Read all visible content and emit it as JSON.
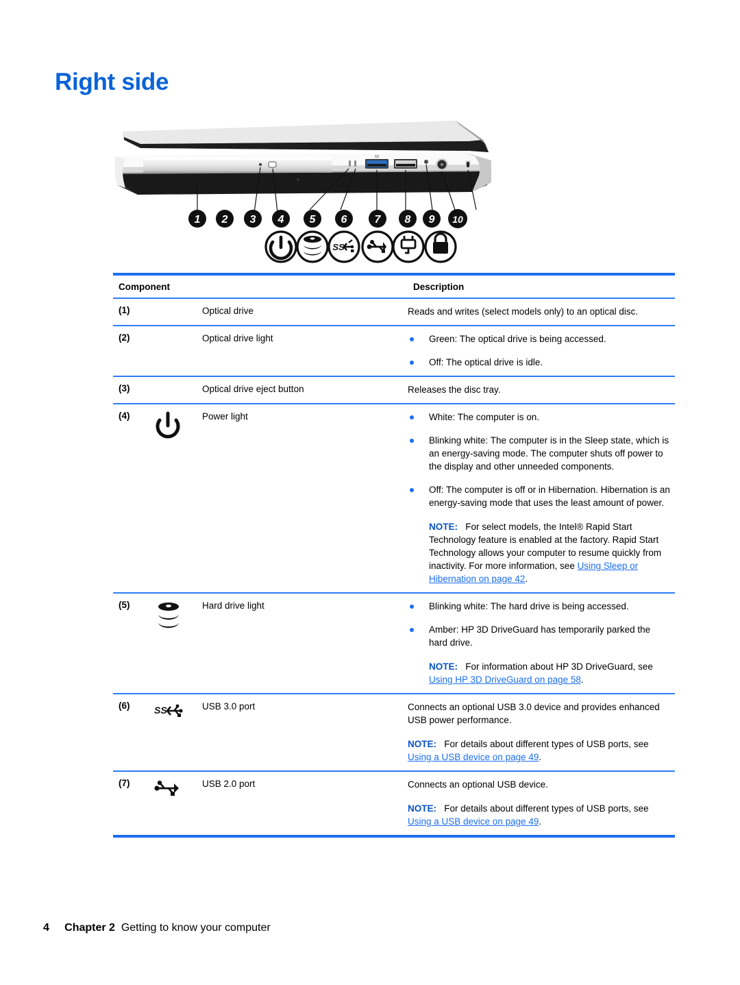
{
  "document": {
    "title": "Right side"
  },
  "figure": {
    "name": "laptop-right-side-photo",
    "callouts": [
      "1",
      "2",
      "3",
      "4",
      "5",
      "6",
      "7",
      "8",
      "9",
      "10"
    ],
    "icons": [
      "power-icon",
      "hard-drive-icon",
      "usb-3-icon",
      "usb-2-icon",
      "power-connector-icon",
      "lock-icon"
    ]
  },
  "table": {
    "headers": {
      "component": "Component",
      "description": "Description"
    },
    "rows": [
      {
        "num": "(1)",
        "icon": "",
        "name": "Optical drive",
        "desc_plain": "Reads and writes (select models only) to an optical disc."
      },
      {
        "num": "(2)",
        "icon": "",
        "name": "Optical drive light",
        "bullets": [
          "Green: The optical drive is being accessed.",
          "Off: The optical drive is idle."
        ]
      },
      {
        "num": "(3)",
        "icon": "",
        "name": "Optical drive eject button",
        "desc_plain": "Releases the disc tray."
      },
      {
        "num": "(4)",
        "icon": "power-icon",
        "name": "Power light",
        "bullets": [
          "White: The computer is on.",
          "Blinking white: The computer is in the Sleep state, which is an energy-saving mode. The computer shuts off power to the display and other unneeded components.",
          "Off: The computer is off or in Hibernation. Hibernation is an energy-saving mode that uses the least amount of power."
        ],
        "note": {
          "label": "NOTE:",
          "text": "For select models, the Intel® Rapid Start Technology feature is enabled at the factory. Rapid Start Technology allows your computer to resume quickly from inactivity. For more information, see ",
          "link": "Using Sleep or Hibernation on page 42",
          "after": "."
        }
      },
      {
        "num": "(5)",
        "icon": "hard-drive-icon",
        "name": "Hard drive light",
        "bullets": [
          "Blinking white: The hard drive is being accessed.",
          "Amber: HP 3D DriveGuard has temporarily parked the hard drive."
        ],
        "note": {
          "label": "NOTE:",
          "text": "For information about HP 3D DriveGuard, see ",
          "link": "Using HP 3D DriveGuard on page 58",
          "after": "."
        }
      },
      {
        "num": "(6)",
        "icon": "usb-3-icon",
        "name": "USB 3.0 port",
        "desc_plain": "Connects an optional USB 3.0 device and provides enhanced USB power performance.",
        "note": {
          "label": "NOTE:",
          "text": "For details about different types of USB ports, see ",
          "link": "Using a USB device on page 49",
          "after": "."
        }
      },
      {
        "num": "(7)",
        "icon": "usb-2-icon",
        "name": "USB 2.0 port",
        "desc_plain": "Connects an optional USB device.",
        "note": {
          "label": "NOTE:",
          "text": "For details about different types of USB ports, see ",
          "link": "Using a USB device on page 49",
          "after": "."
        }
      }
    ]
  },
  "footer": {
    "page_number": "4",
    "chapter": "Chapter 2",
    "chapter_title": "Getting to know your computer"
  },
  "colors": {
    "accent_blue": "#1b6ef3",
    "title_blue": "#0a63d8",
    "note_blue": "#0a53c4"
  }
}
